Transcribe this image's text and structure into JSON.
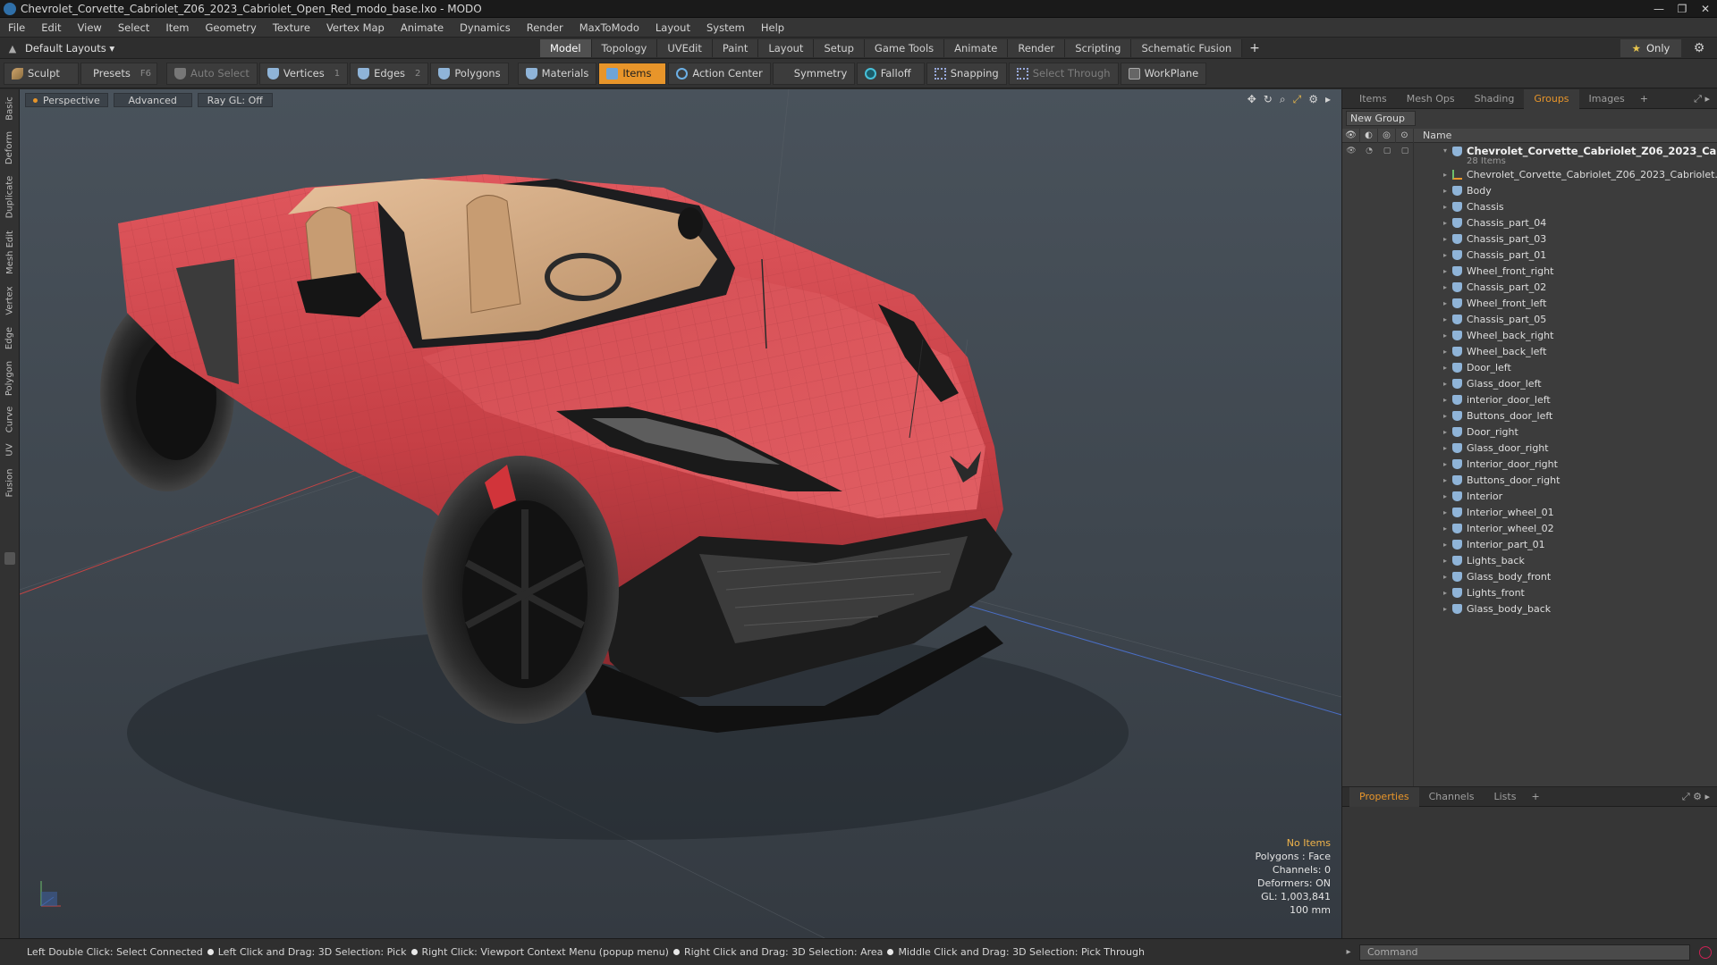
{
  "window": {
    "title": "Chevrolet_Corvette_Cabriolet_Z06_2023_Cabriolet_Open_Red_modo_base.lxo - MODO",
    "controls": [
      "—",
      "❐",
      "✕"
    ]
  },
  "menu": [
    "File",
    "Edit",
    "View",
    "Select",
    "Item",
    "Geometry",
    "Texture",
    "Vertex Map",
    "Animate",
    "Dynamics",
    "Render",
    "MaxToModo",
    "Layout",
    "System",
    "Help"
  ],
  "layout": {
    "selector": "Default Layouts ▾",
    "tabs": [
      "Model",
      "Topology",
      "UVEdit",
      "Paint",
      "Layout",
      "Setup",
      "Game Tools",
      "Animate",
      "Render",
      "Scripting",
      "Schematic Fusion"
    ],
    "active_tab": "Model",
    "add_symbol": "+",
    "only_label": "Only",
    "only_star": "★"
  },
  "toolbar": {
    "sculpt": "Sculpt",
    "presets": "Presets",
    "presets_key": "F6",
    "auto_select": "Auto Select",
    "vertices": "Vertices",
    "vertices_key": "1",
    "edges": "Edges",
    "edges_key": "2",
    "polygons": "Polygons",
    "materials": "Materials",
    "items": "Items",
    "action_center": "Action Center",
    "symmetry": "Symmetry",
    "falloff": "Falloff",
    "snapping": "Snapping",
    "select_through": "Select Through",
    "workplane": "WorkPlane"
  },
  "left_tabs": [
    "Basic",
    "Deform",
    "Duplicate",
    "Mesh Edit",
    "Vertex",
    "Edge",
    "Polygon",
    "Curve",
    "UV",
    "Fusion"
  ],
  "viewport": {
    "view_mode": "Perspective",
    "shading": "Advanced",
    "raygl": "Ray GL: Off",
    "info": [
      "No Items",
      "Polygons : Face",
      "Channels: 0",
      "Deformers: ON",
      "GL: 1,003,841",
      "100 mm"
    ]
  },
  "items_panel": {
    "tabs": [
      "Items",
      "Mesh Ops",
      "Shading",
      "Groups",
      "Images"
    ],
    "active_tab": "Groups",
    "new_group": "New Group",
    "col_name": "Name",
    "group_name": "Chevrolet_Corvette_Cabriolet_Z06_2023_Ca ...",
    "group_count": "28 Items",
    "items": [
      "Chevrolet_Corvette_Cabriolet_Z06_2023_Cabriolet...",
      "Body",
      "Chassis",
      "Chassis_part_04",
      "Chassis_part_03",
      "Chassis_part_01",
      "Wheel_front_right",
      "Chassis_part_02",
      "Wheel_front_left",
      "Chassis_part_05",
      "Wheel_back_right",
      "Wheel_back_left",
      "Door_left",
      "Glass_door_left",
      "interior_door_left",
      "Buttons_door_left",
      "Door_right",
      "Glass_door_right",
      "Interior_door_right",
      "Buttons_door_right",
      "Interior",
      "Interior_wheel_01",
      "Interior_wheel_02",
      "Interior_part_01",
      "Lights_back",
      "Glass_body_front",
      "Lights_front",
      "Glass_body_back"
    ]
  },
  "properties_panel": {
    "tabs": [
      "Properties",
      "Channels",
      "Lists"
    ],
    "active_tab": "Properties"
  },
  "statusbar": {
    "hints": [
      "Left Double Click: Select Connected",
      "Left Click and Drag: 3D Selection: Pick",
      "Right Click: Viewport Context Menu (popup menu)",
      "Right Click and Drag: 3D Selection: Area",
      "Middle Click and Drag: 3D Selection: Pick Through"
    ]
  },
  "command": {
    "placeholder": "Command"
  },
  "colors": {
    "accent": "#e8952a",
    "car_body": "#c9434a",
    "viewport_bg": "#434b53"
  }
}
